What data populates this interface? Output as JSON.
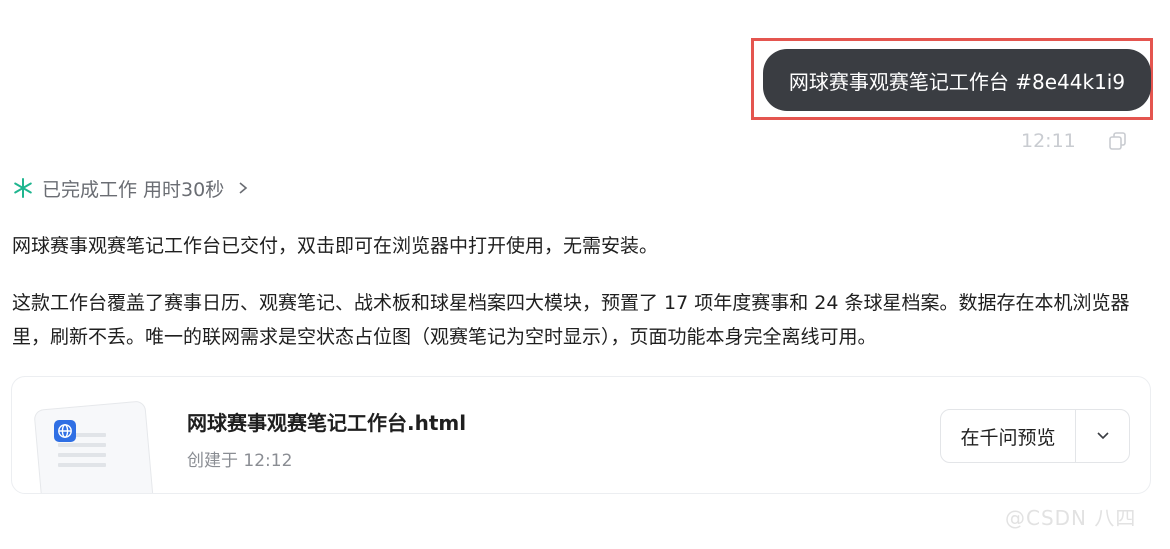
{
  "user_message": {
    "text": "网球赛事观赛笔记工作台 #8e44k1i9",
    "time": "12:11"
  },
  "status": {
    "text": "已完成工作 用时30秒"
  },
  "reply": {
    "paragraphs": [
      "网球赛事观赛笔记工作台已交付，双击即可在浏览器中打开使用，无需安装。",
      "这款工作台覆盖了赛事日历、观赛笔记、战术板和球星档案四大模块，预置了 17 项年度赛事和 24 条球星档案。数据存在本机浏览器里，刷新不丢。唯一的联网需求是空状态占位图（观赛笔记为空时显示），页面功能本身完全离线可用。"
    ]
  },
  "file_card": {
    "name": "网球赛事观赛笔记工作台.html",
    "meta": "创建于 12:12",
    "preview_label": "在千问预览"
  },
  "watermark": "@CSDN 八四",
  "colors": {
    "bubble": "#3a3d42",
    "highlight": "#e4554f",
    "status_icon": "#1fb58f",
    "file_badge": "#2f6fe4"
  }
}
